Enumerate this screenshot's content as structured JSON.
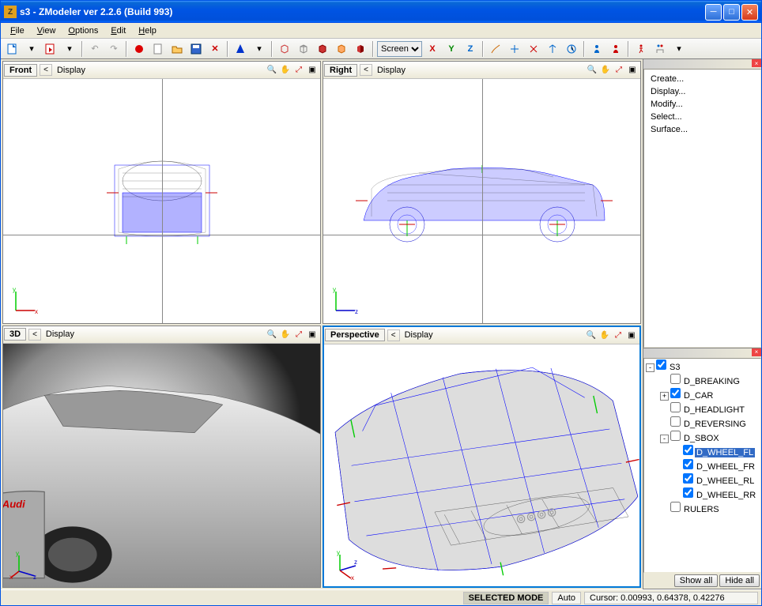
{
  "window": {
    "title": "s3 - ZModeler ver 2.2.6 (Build 993)"
  },
  "menu": {
    "file": "File",
    "view": "View",
    "options": "Options",
    "edit": "Edit",
    "help": "Help"
  },
  "toolbar": {
    "coord_dropdown": "Screen",
    "axes": {
      "x": "X",
      "y": "Y",
      "z": "Z"
    }
  },
  "viewports": {
    "front": {
      "label": "Front",
      "display": "Display",
      "arrow": "<"
    },
    "right": {
      "label": "Right",
      "display": "Display",
      "arrow": "<"
    },
    "view3d": {
      "label": "3D",
      "display": "Display",
      "arrow": "<"
    },
    "perspective": {
      "label": "Perspective",
      "display": "Display",
      "arrow": "<"
    }
  },
  "commands": {
    "items": [
      "Create...",
      "Display...",
      "Modify...",
      "Select...",
      "Surface..."
    ]
  },
  "tree": {
    "root": "S3",
    "nodes": [
      {
        "label": "D_BREAKING",
        "checked": false,
        "indent": 1,
        "exp": ""
      },
      {
        "label": "D_CAR",
        "checked": true,
        "indent": 1,
        "exp": "+"
      },
      {
        "label": "D_HEADLIGHT",
        "checked": false,
        "indent": 1,
        "exp": ""
      },
      {
        "label": "D_REVERSING",
        "checked": false,
        "indent": 1,
        "exp": ""
      },
      {
        "label": "D_SBOX",
        "checked": false,
        "indent": 1,
        "exp": "-"
      },
      {
        "label": "D_WHEEL_FL",
        "checked": true,
        "indent": 2,
        "exp": "",
        "selected": true
      },
      {
        "label": "D_WHEEL_FR",
        "checked": true,
        "indent": 2,
        "exp": ""
      },
      {
        "label": "D_WHEEL_RL",
        "checked": true,
        "indent": 2,
        "exp": ""
      },
      {
        "label": "D_WHEEL_RR",
        "checked": true,
        "indent": 2,
        "exp": ""
      },
      {
        "label": "RULERS",
        "checked": false,
        "indent": 1,
        "exp": ""
      }
    ],
    "show_all": "Show all",
    "hide_all": "Hide all"
  },
  "status": {
    "mode": "SELECTED MODE",
    "auto": "Auto",
    "cursor": "Cursor: 0.00993, 0.64378, 0.42276"
  }
}
